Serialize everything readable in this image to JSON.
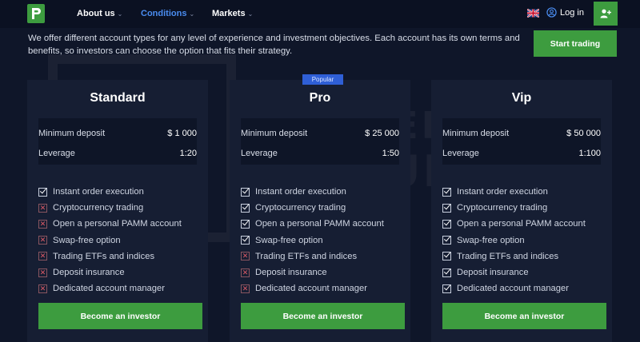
{
  "header": {
    "logo_icon": "brand-p-icon",
    "nav": [
      {
        "label": "About us",
        "active": false
      },
      {
        "label": "Conditions",
        "active": true
      },
      {
        "label": "Markets",
        "active": false
      }
    ],
    "language_icon": "uk-flag-icon",
    "login_label": "Log in",
    "user_icon": "user-plus-icon"
  },
  "intro": {
    "text": "We offer different account types for any level of experience and investment objectives. Each account has its own terms and benefits, so investors can choose the option that fits their strategy.",
    "cta_label": "Start trading"
  },
  "watermark": {
    "line1": "BROKER",
    "line2": "TRIBUNAL"
  },
  "colors": {
    "accent_green": "#3d9c3f",
    "active_nav": "#4a8cf0",
    "badge_blue": "#2f5fd6",
    "background": "#0f1629",
    "card": "#161e33"
  },
  "plans": [
    {
      "name": "Standard",
      "badge": "",
      "min_deposit_label": "Minimum deposit",
      "min_deposit_value": "$ 1 000",
      "leverage_label": "Leverage",
      "leverage_value": "1:20",
      "features": [
        {
          "label": "Instant order execution",
          "included": true
        },
        {
          "label": "Cryptocurrency trading",
          "included": false
        },
        {
          "label": "Open a personal PAMM account",
          "included": false
        },
        {
          "label": "Swap-free option",
          "included": false
        },
        {
          "label": "Trading ETFs and indices",
          "included": false
        },
        {
          "label": "Deposit insurance",
          "included": false
        },
        {
          "label": "Dedicated account manager",
          "included": false
        }
      ],
      "cta_label": "Become an investor"
    },
    {
      "name": "Pro",
      "badge": "Popular",
      "min_deposit_label": "Minimum deposit",
      "min_deposit_value": "$ 25 000",
      "leverage_label": "Leverage",
      "leverage_value": "1:50",
      "features": [
        {
          "label": "Instant order execution",
          "included": true
        },
        {
          "label": "Cryptocurrency trading",
          "included": true
        },
        {
          "label": "Open a personal PAMM account",
          "included": true
        },
        {
          "label": "Swap-free option",
          "included": true
        },
        {
          "label": "Trading ETFs and indices",
          "included": false
        },
        {
          "label": "Deposit insurance",
          "included": false
        },
        {
          "label": "Dedicated account manager",
          "included": false
        }
      ],
      "cta_label": "Become an investor"
    },
    {
      "name": "Vip",
      "badge": "",
      "min_deposit_label": "Minimum deposit",
      "min_deposit_value": "$ 50 000",
      "leverage_label": "Leverage",
      "leverage_value": "1:100",
      "features": [
        {
          "label": "Instant order execution",
          "included": true
        },
        {
          "label": "Cryptocurrency trading",
          "included": true
        },
        {
          "label": "Open a personal PAMM account",
          "included": true
        },
        {
          "label": "Swap-free option",
          "included": true
        },
        {
          "label": "Trading ETFs and indices",
          "included": true
        },
        {
          "label": "Deposit insurance",
          "included": true
        },
        {
          "label": "Dedicated account manager",
          "included": true
        }
      ],
      "cta_label": "Become an investor"
    }
  ]
}
